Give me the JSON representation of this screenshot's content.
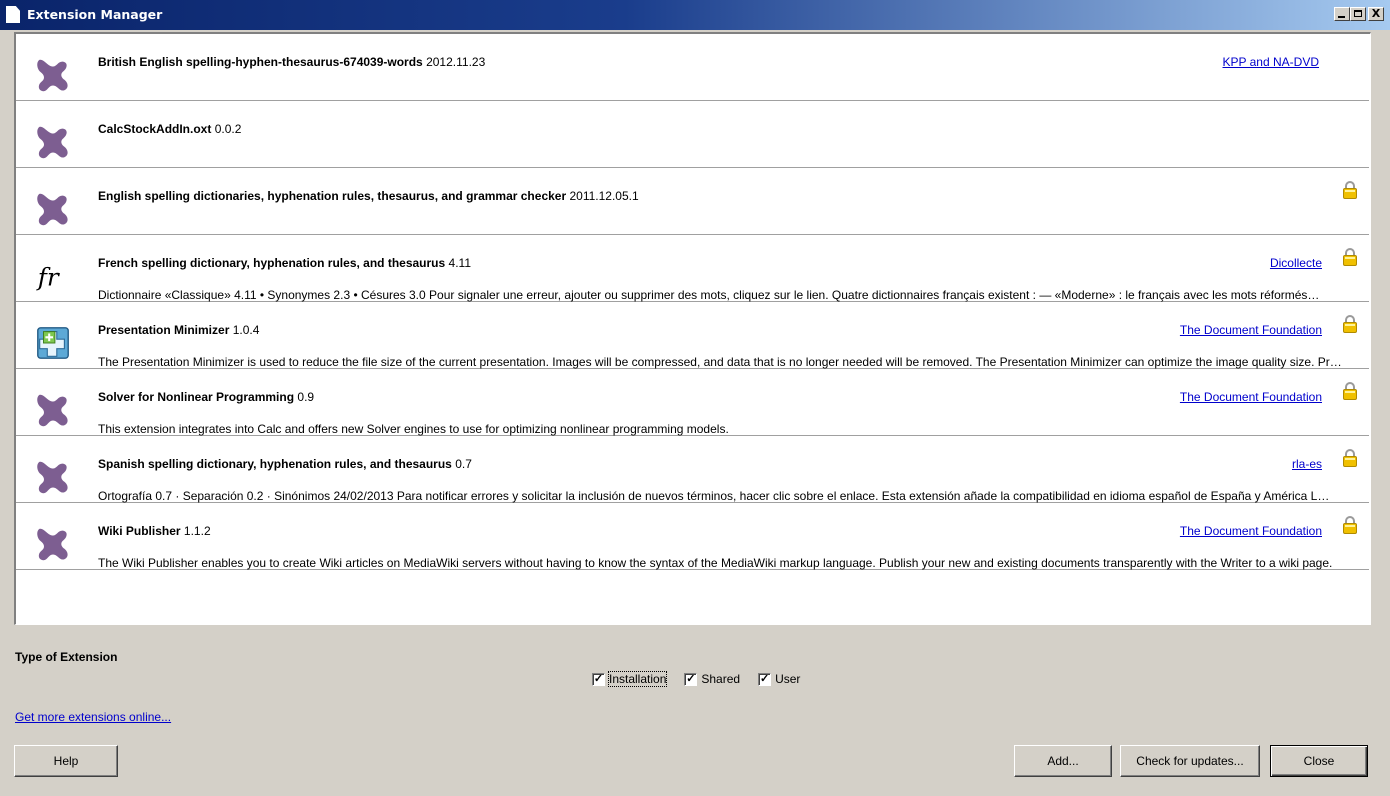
{
  "window": {
    "title": "Extension Manager",
    "minimize": "_",
    "maximize": "□",
    "close": "X"
  },
  "extensions": [
    {
      "icon": "puzzle-icon",
      "name": "British English spelling-hyphen-thesaurus-674039-words",
      "version": "2012.11.23",
      "description": "",
      "publisher": "KPP and NA-DVD",
      "locked": false
    },
    {
      "icon": "puzzle-icon",
      "name": "CalcStockAddIn.oxt",
      "version": "0.0.2",
      "description": "",
      "publisher": "",
      "locked": false
    },
    {
      "icon": "puzzle-icon",
      "name": "English spelling dictionaries, hyphenation rules, thesaurus, and grammar checker",
      "version": "2011.12.05.1",
      "description": "",
      "publisher": "",
      "locked": true
    },
    {
      "icon": "fr-icon",
      "name": "French spelling dictionary, hyphenation rules, and thesaurus",
      "version": "4.11",
      "description": "Dictionnaire «Classique» 4.11 • Synonymes 2.3 • Césures 3.0  Pour signaler une erreur, ajouter ou supprimer des mots, cliquez sur le lien.  Quatre dictionnaires français existent :  — «Moderne» : le français avec les mots réformés…",
      "publisher": "Dicollecte",
      "locked": true
    },
    {
      "icon": "puzzle-add-icon",
      "name": "Presentation Minimizer",
      "version": "1.0.4",
      "description": "The Presentation Minimizer is used to reduce the file size of the current presentation. Images will be compressed, and data that is no longer needed will be removed. The Presentation Minimizer can optimize the image quality size. Pr…",
      "publisher": "The Document Foundation",
      "locked": true
    },
    {
      "icon": "puzzle-icon",
      "name": "Solver for Nonlinear Programming",
      "version": "0.9",
      "description": "This extension integrates into Calc and offers new Solver engines to use for optimizing nonlinear programming models.",
      "publisher": "The Document Foundation",
      "locked": true
    },
    {
      "icon": "puzzle-icon",
      "name": "Spanish spelling dictionary, hyphenation rules, and thesaurus",
      "version": "0.7",
      "description": "Ortografía 0.7 · Separación 0.2 · Sinónimos 24/02/2013  Para notificar errores y solicitar la inclusión de nuevos términos, hacer clic sobre el enlace.  Esta extensión añade la compatibilidad en idioma español de España y América L…",
      "publisher": "rla-es",
      "locked": true
    },
    {
      "icon": "puzzle-icon",
      "name": "Wiki Publisher",
      "version": "1.1.2",
      "description": "The Wiki Publisher enables you to create Wiki articles on MediaWiki servers without having to know the syntax of the MediaWiki markup language. Publish your new and existing documents transparently with the Writer to a wiki page.",
      "publisher": "The Document Foundation",
      "locked": true
    }
  ],
  "footer": {
    "type_label": "Type of Extension",
    "checkboxes": [
      {
        "label": "Installation",
        "checked": true
      },
      {
        "label": "Shared",
        "checked": true
      },
      {
        "label": "User",
        "checked": true
      }
    ],
    "more_link": "Get more extensions online...",
    "buttons": {
      "help": "Help",
      "add": "Add...",
      "check_updates": "Check for updates...",
      "close": "Close"
    }
  },
  "colors": {
    "link": "#0000cc",
    "puzzle": "#7d5e91",
    "titlebar": "#0a246a",
    "lock": "#f0c000"
  }
}
